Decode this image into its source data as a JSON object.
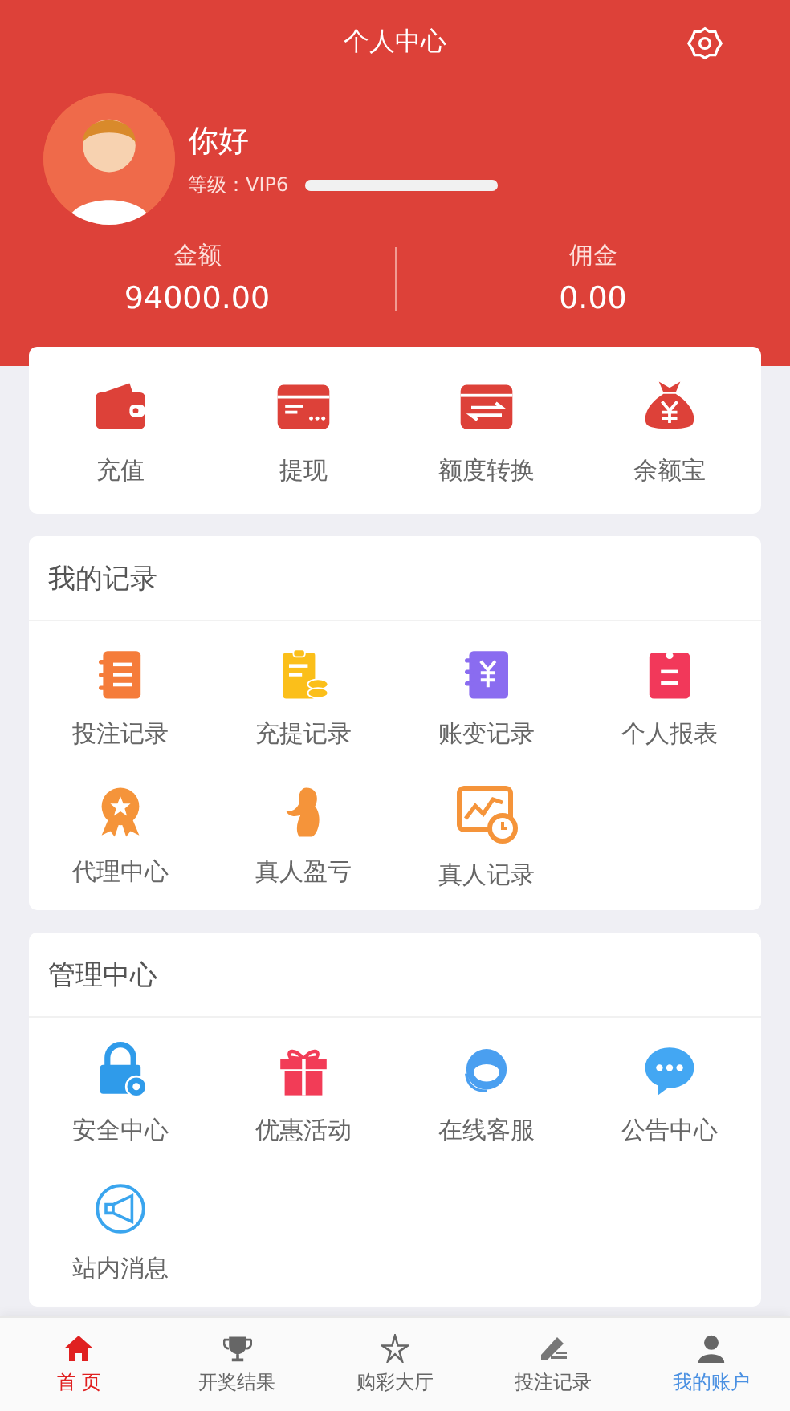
{
  "header": {
    "title": "个人中心",
    "greeting": "你好",
    "level_text": "等级：VIP6",
    "level": 1,
    "stats": [
      {
        "label": "金额",
        "value": "94000.00"
      },
      {
        "label": "佣金",
        "value": "0.00"
      }
    ]
  },
  "quick_actions": [
    {
      "label": "充值"
    },
    {
      "label": "提现"
    },
    {
      "label": "额度转换"
    },
    {
      "label": "余额宝"
    }
  ],
  "sections": [
    {
      "title": "我的记录",
      "items": [
        {
          "label": "投注记录"
        },
        {
          "label": "充提记录"
        },
        {
          "label": "账变记录"
        },
        {
          "label": "个人报表"
        },
        {
          "label": "代理中心"
        },
        {
          "label": "真人盈亏"
        },
        {
          "label": "真人记录"
        }
      ]
    },
    {
      "title": "管理中心",
      "items": [
        {
          "label": "安全中心"
        },
        {
          "label": "优惠活动"
        },
        {
          "label": "在线客服"
        },
        {
          "label": "公告中心"
        },
        {
          "label": "站内消息"
        }
      ]
    }
  ],
  "tab_bar": [
    {
      "label": "首 页",
      "color": "#e02020"
    },
    {
      "label": "开奖结果",
      "color": "#666666"
    },
    {
      "label": "购彩大厅",
      "color": "#666666"
    },
    {
      "label": "投注记录",
      "color": "#666666"
    },
    {
      "label": "我的账户",
      "color": "#4a90e2"
    }
  ]
}
